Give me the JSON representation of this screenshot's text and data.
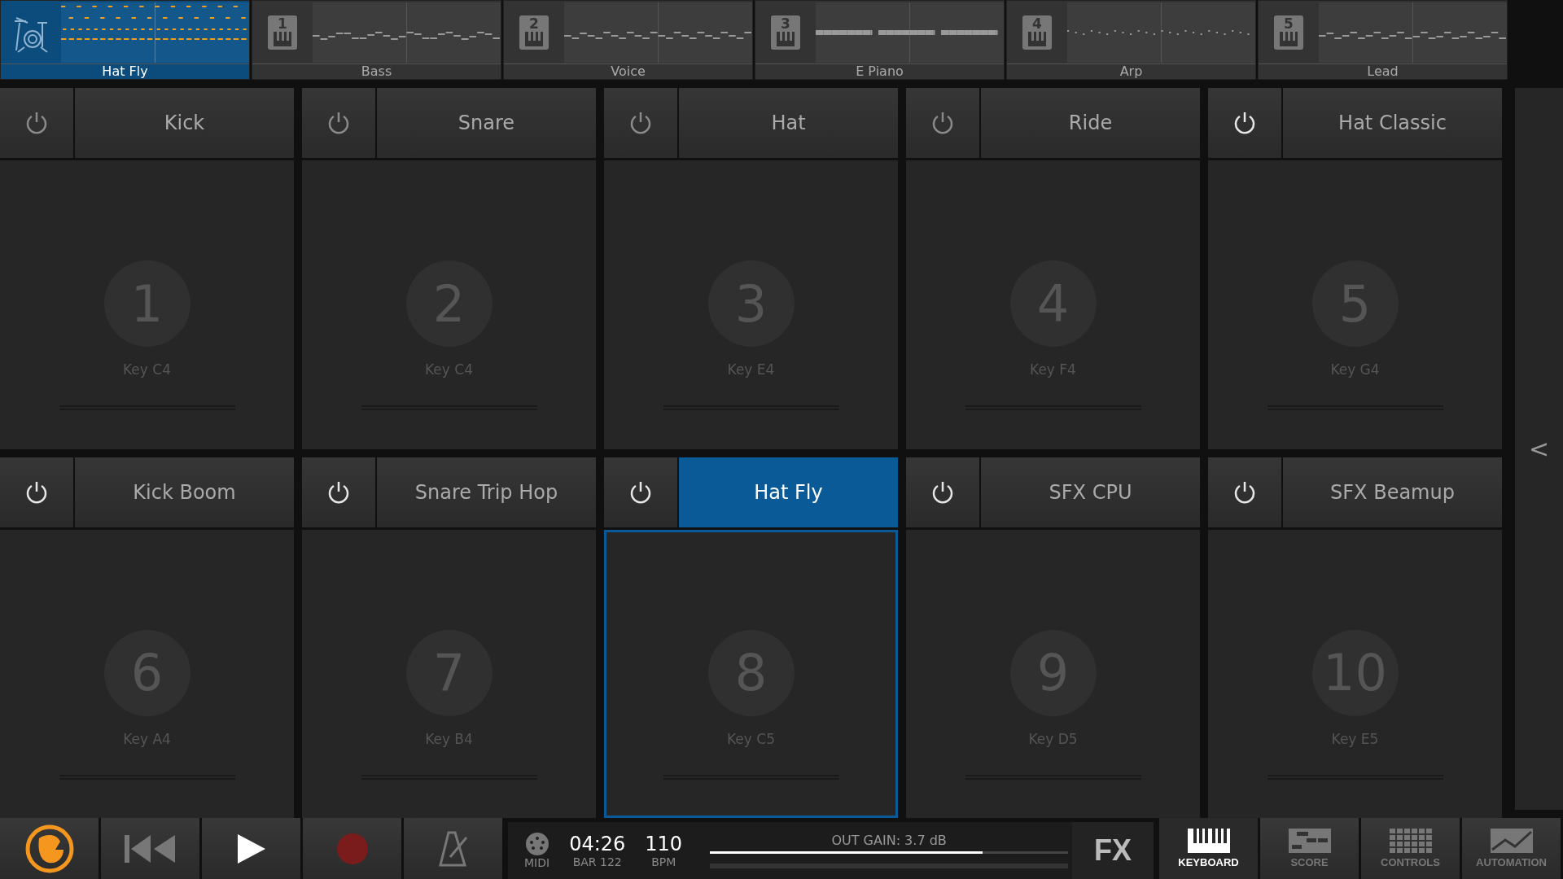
{
  "tracks": [
    {
      "kind": "drum",
      "name": "Hat Fly",
      "selected": true
    },
    {
      "kind": "synth",
      "number": "1",
      "name": "Bass",
      "selected": false
    },
    {
      "kind": "synth",
      "number": "2",
      "name": "Voice",
      "selected": false
    },
    {
      "kind": "synth",
      "number": "3",
      "name": "E Piano",
      "selected": false
    },
    {
      "kind": "synth",
      "number": "4",
      "name": "Arp",
      "selected": false
    },
    {
      "kind": "synth",
      "number": "5",
      "name": "Lead",
      "selected": false
    }
  ],
  "pads": [
    {
      "name": "Kick",
      "on": false,
      "number": "1",
      "key": "Key C4",
      "selected": false
    },
    {
      "name": "Snare",
      "on": false,
      "number": "2",
      "key": "Key C4",
      "selected": false
    },
    {
      "name": "Hat",
      "on": false,
      "number": "3",
      "key": "Key E4",
      "selected": false
    },
    {
      "name": "Ride",
      "on": false,
      "number": "4",
      "key": "Key F4",
      "selected": false
    },
    {
      "name": "Hat Classic",
      "on": true,
      "number": "5",
      "key": "Key G4",
      "selected": false
    },
    {
      "name": "Kick Boom",
      "on": true,
      "number": "6",
      "key": "Key A4",
      "selected": false
    },
    {
      "name": "Snare Trip Hop",
      "on": true,
      "number": "7",
      "key": "Key B4",
      "selected": false
    },
    {
      "name": "Hat Fly",
      "on": true,
      "number": "8",
      "key": "Key C5",
      "selected": true
    },
    {
      "name": "SFX CPU",
      "on": true,
      "number": "9",
      "key": "Key D5",
      "selected": false
    },
    {
      "name": "SFX Beamup",
      "on": true,
      "number": "10",
      "key": "Key E5",
      "selected": false
    }
  ],
  "sidebar": {
    "toggle": "<"
  },
  "transport": {
    "time": "04:26",
    "bar": "BAR 122",
    "tempo": "110",
    "tempo_label": "BPM",
    "midi_label": "MIDI",
    "gain_label": "OUT GAIN: 3.7 dB",
    "gain": {
      "level": 0.76
    },
    "fx": "FX"
  },
  "view_tabs": [
    {
      "kind": "keyboard",
      "label": "KEYBOARD",
      "selected": true
    },
    {
      "kind": "score",
      "label": "SCORE",
      "selected": false
    },
    {
      "kind": "controls",
      "label": "CONTROLS",
      "selected": false
    },
    {
      "kind": "automation",
      "label": "AUTOMATION",
      "selected": false
    }
  ]
}
